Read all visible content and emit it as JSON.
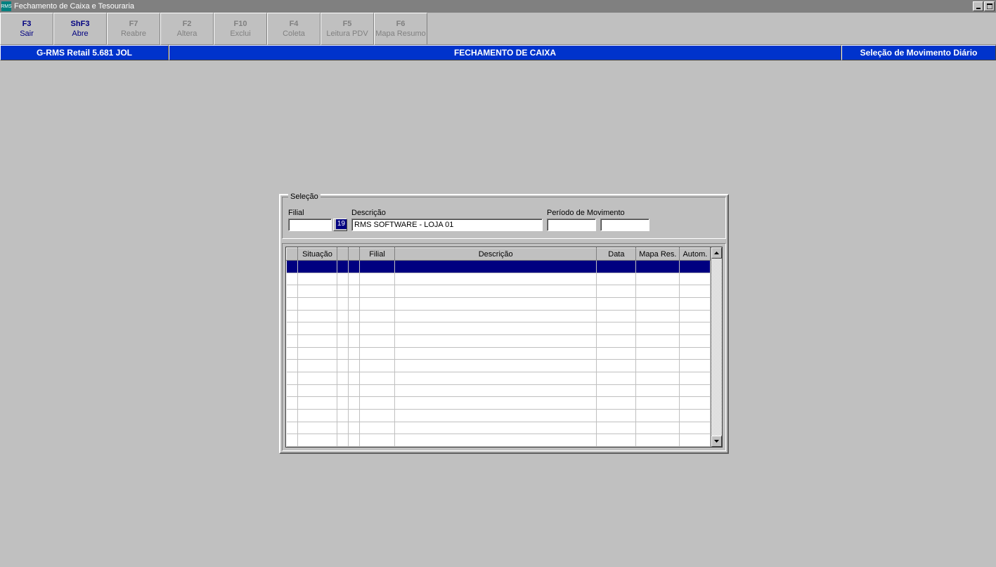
{
  "window": {
    "icon_text": "RMS",
    "title": "Fechamento de Caixa e Tesouraria"
  },
  "toolbar": [
    {
      "key": "F3",
      "label": "Sair"
    },
    {
      "key": "ShF3",
      "label": "Abre"
    },
    {
      "key": "F7",
      "label": "Reabre"
    },
    {
      "key": "F2",
      "label": "Altera"
    },
    {
      "key": "F10",
      "label": "Exclui"
    },
    {
      "key": "F4",
      "label": "Coleta"
    },
    {
      "key": "F5",
      "label": "Leitura PDV"
    },
    {
      "key": "F6",
      "label": "Mapa Resumo"
    }
  ],
  "bluebar": {
    "left": "G-RMS Retail 5.681 JOL",
    "center": "FECHAMENTO DE CAIXA",
    "right": "Seleção de Movimento Diário"
  },
  "selecao": {
    "legend": "Seleção",
    "filial_label": "Filial",
    "filial_value": "19",
    "descricao_label": "Descrição",
    "descricao_value": "RMS SOFTWARE - LOJA 01",
    "periodo_label": "Período de Movimento",
    "periodo_from": "",
    "periodo_to": ""
  },
  "grid": {
    "columns": [
      "",
      "Situação",
      "",
      "",
      "Filial",
      "Descrição",
      "Data",
      "Mapa Res.",
      "Autom."
    ]
  }
}
